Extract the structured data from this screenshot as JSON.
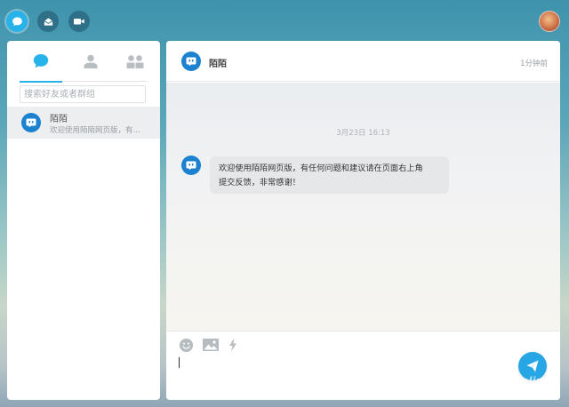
{
  "colors": {
    "accent": "#27b3e9",
    "bot_blue": "#1c82cf",
    "send": "#27a6e6"
  },
  "nav": {
    "items": [
      {
        "icon": "chat-bubble-icon",
        "active": true
      },
      {
        "icon": "mail-icon",
        "active": false
      },
      {
        "icon": "video-camera-icon",
        "active": false
      }
    ]
  },
  "sidebar": {
    "tabs": [
      {
        "icon": "chat-bubble-icon",
        "active": true
      },
      {
        "icon": "contact-icon",
        "active": false
      },
      {
        "icon": "group-icon",
        "active": false
      }
    ],
    "search": {
      "placeholder": "搜索好友或者群组",
      "value": ""
    },
    "conversations": [
      {
        "name": "陌陌",
        "preview": "欢迎使用陌陌网页版，有…",
        "icon": "momo-bot-icon"
      }
    ]
  },
  "chat": {
    "title": "陌陌",
    "status": "1分钟前",
    "timestamp": "3月23日 16:13",
    "messages": [
      {
        "sender": "陌陌",
        "lines": [
          "欢迎使用陌陌网页版，有任何问题和建议请在页面右上角",
          "提交反馈，非常感谢！"
        ]
      }
    ],
    "input": {
      "value": "",
      "placeholder": ""
    },
    "tools": [
      "emoji-icon",
      "image-icon",
      "flash-icon"
    ]
  },
  "watermark": {
    "brand": "PConline",
    "sub": "太平洋电脑网"
  }
}
